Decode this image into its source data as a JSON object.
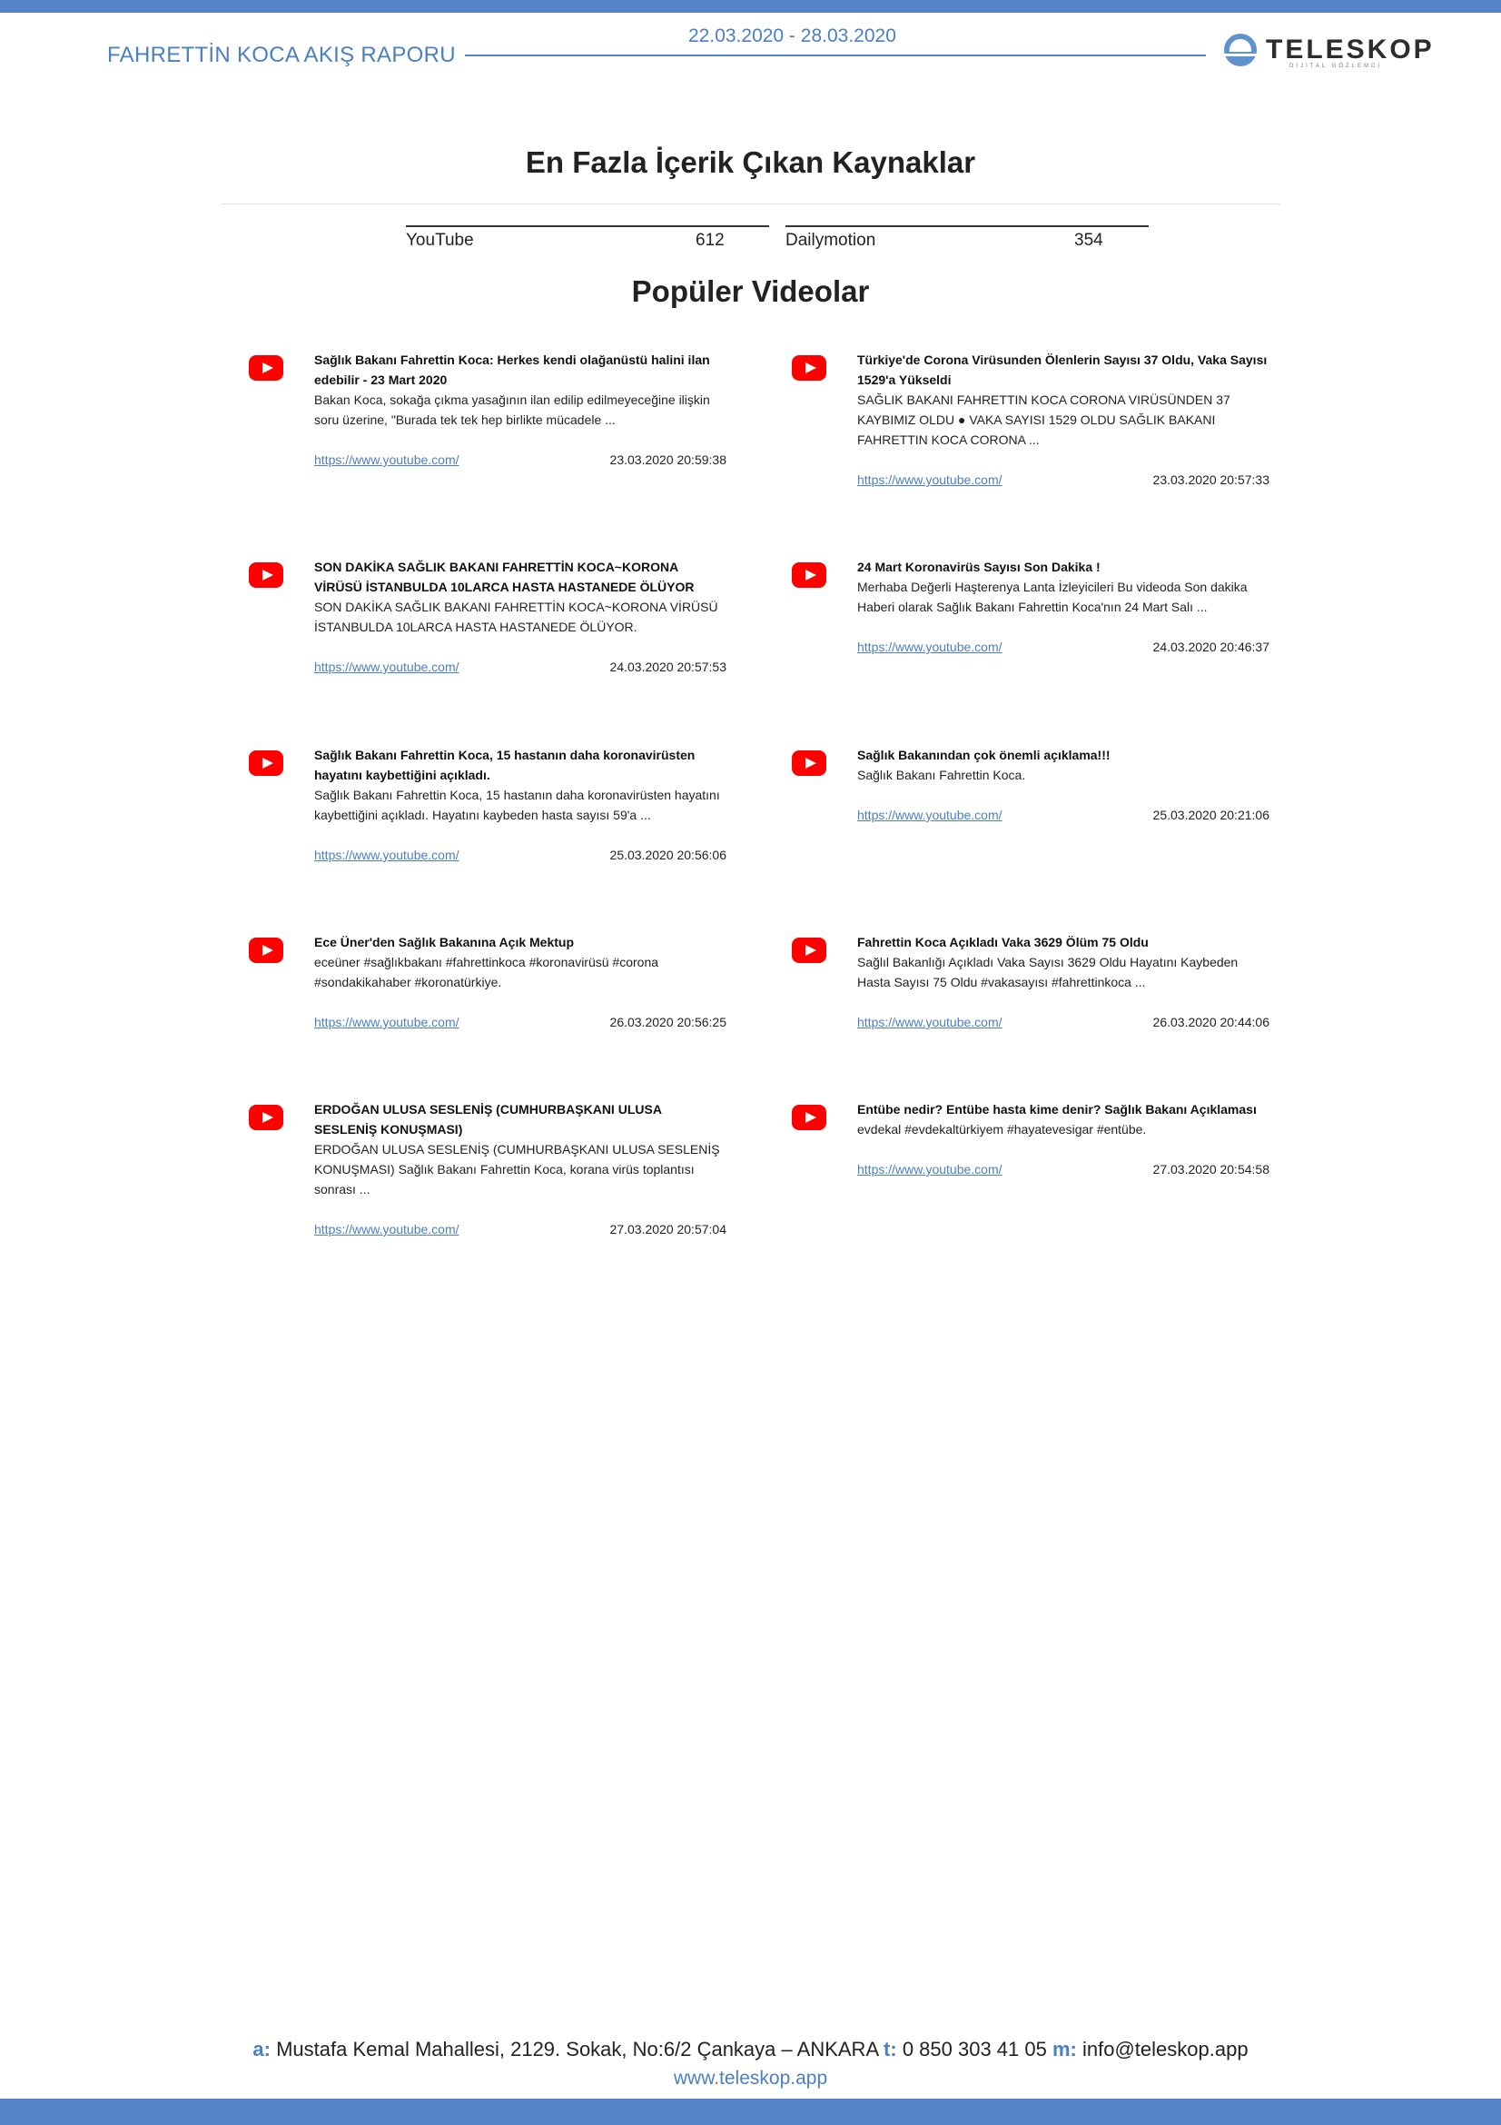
{
  "header": {
    "report_title": "FAHRETTİN KOCA AKIŞ RAPORU",
    "date_range": "22.03.2020 - 28.03.2020",
    "logo_text": "TELESKOP",
    "logo_subtext": "DİJİTAL GÖZLEMCİ"
  },
  "sources": {
    "title": "En Fazla İçerik Çıkan Kaynaklar",
    "items": [
      {
        "name": "YouTube",
        "count": "612"
      },
      {
        "name": "Dailymotion",
        "count": "354"
      }
    ]
  },
  "videos": {
    "title": "Popüler Videolar",
    "icon": "youtube-icon",
    "items": [
      {
        "title": "Sağlık Bakanı Fahrettin Koca: Herkes kendi olağanüstü halini ilan edebilir - 23 Mart 2020",
        "description": "Bakan Koca, sokağa çıkma yasağının ilan edilip edilmeyeceğine ilişkin soru üzerine, \"Burada tek tek hep birlikte mücadele ...",
        "link": "https://www.youtube.com/",
        "date": "23.03.2020 20:59:38"
      },
      {
        "title": "Türkiye'de Corona Virüsunden Ölenlerin Sayısı 37 Oldu, Vaka Sayısı 1529'a Yükseldi",
        "description": "SAĞLIK BAKANI FAHRETTIN KOCA CORONA VIRÜSÜNDEN 37 KAYBIMIZ OLDU ● VAKA SAYISI 1529 OLDU SAĞLIK BAKANI FAHRETTIN KOCA CORONA ...",
        "link": "https://www.youtube.com/",
        "date": "23.03.2020 20:57:33"
      },
      {
        "title": "SON DAKİKA SAĞLIK BAKANI FAHRETTİN KOCA~KORONA VİRÜSÜ İSTANBULDA 10LARCA HASTA HASTANEDE ÖLÜYOR",
        "description": "SON DAKİKA SAĞLIK BAKANI FAHRETTİN KOCA~KORONA VİRÜSÜ İSTANBULDA 10LARCA HASTA HASTANEDE ÖLÜYOR.",
        "link": "https://www.youtube.com/",
        "date": "24.03.2020 20:57:53"
      },
      {
        "title": "24 Mart Koronavirüs Sayısı Son Dakika !",
        "description": "Merhaba Değerli Haşterenya Lanta İzleyicileri Bu videoda Son dakika Haberi olarak Sağlık Bakanı Fahrettin Koca'nın 24 Mart Salı ...",
        "link": "https://www.youtube.com/",
        "date": "24.03.2020 20:46:37"
      },
      {
        "title": "Sağlık Bakanı Fahrettin Koca, 15 hastanın daha koronavirüsten hayatını kaybettiğini açıkladı.",
        "description": "Sağlık Bakanı Fahrettin Koca, 15 hastanın daha koronavirüsten hayatını kaybettiğini açıkladı. Hayatını kaybeden hasta sayısı 59'a ...",
        "link": "https://www.youtube.com/",
        "date": "25.03.2020 20:56:06"
      },
      {
        "title": "Sağlık Bakanından çok önemli açıklama!!!",
        "description": "Sağlık Bakanı Fahrettin Koca.",
        "link": "https://www.youtube.com/",
        "date": "25.03.2020 20:21:06"
      },
      {
        "title": "Ece Üner'den Sağlık Bakanına Açık Mektup",
        "description": "eceüner #sağlıkbakanı #fahrettinkoca #koronavirüsü #corona #sondakikahaber #koronatürkiye.",
        "link": "https://www.youtube.com/",
        "date": "26.03.2020 20:56:25"
      },
      {
        "title": "Fahrettin Koca Açıkladı Vaka 3629 Ölüm 75 Oldu",
        "description": "Sağlıl Bakanlığı Açıkladı Vaka Sayısı 3629 Oldu Hayatını Kaybeden Hasta Sayısı 75 Oldu #vakasayısı #fahrettinkoca ...",
        "link": "https://www.youtube.com/",
        "date": "26.03.2020 20:44:06"
      },
      {
        "title": "ERDOĞAN ULUSA SESLENİŞ (CUMHURBAŞKANI ULUSA SESLENİŞ KONUŞMASI)",
        "description": "ERDOĞAN ULUSA SESLENİŞ (CUMHURBAŞKANI ULUSA SESLENİŞ KONUŞMASI) Sağlık Bakanı Fahrettin Koca, korana virüs toplantısı sonrası ...",
        "link": "https://www.youtube.com/",
        "date": "27.03.2020 20:57:04"
      },
      {
        "title": "Entübe nedir? Entübe hasta kime denir? Sağlık Bakanı Açıklaması",
        "description": "evdekal #evdekaltürkiyem #hayatevesigar #entübe.",
        "link": "https://www.youtube.com/",
        "date": "27.03.2020 20:54:58"
      }
    ]
  },
  "footer": {
    "address_label": "a:",
    "address": "Mustafa Kemal Mahallesi, 2129. Sokak, No:6/2 Çankaya – ANKARA",
    "phone_label": "t:",
    "phone": "0 850 303 41 05",
    "email_label": "m:",
    "email": "info@teleskop.app",
    "website": "www.teleskop.app"
  },
  "colors": {
    "accent": "#5585c8",
    "youtube": "#ff0000"
  }
}
